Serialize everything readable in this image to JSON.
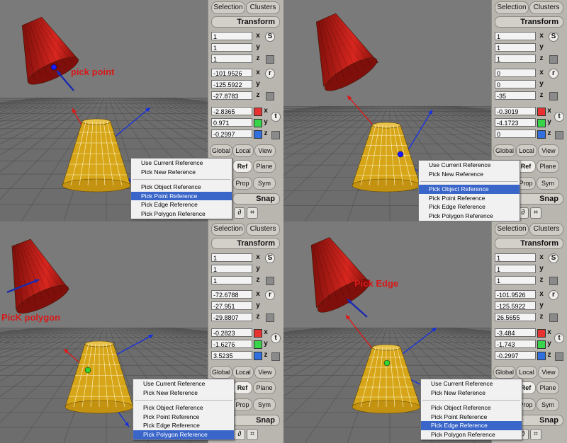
{
  "panel": {
    "tab_selection": "Selection",
    "tab_clusters": "Clusters",
    "transform_title": "Transform",
    "axis_x": "x",
    "axis_y": "y",
    "axis_z": "z",
    "btn_s": "S",
    "btn_r": "r",
    "btn_t": "t",
    "btn_global": "Global",
    "btn_local": "Local",
    "btn_view": "View",
    "btn_ref": "Ref",
    "btn_plane": "Plane",
    "btn_prop": "Prop",
    "btn_sym": "Sym",
    "snap_title": "Snap",
    "colors": {
      "x": "#e83232",
      "y": "#38d44a",
      "z": "#2f6fe0"
    }
  },
  "menu": {
    "items": [
      "Use Current Reference",
      "Pick New Reference",
      "Pick Object Reference",
      "Pick Point Reference",
      "Pick Edge Reference",
      "Pick Polygon Reference"
    ],
    "selected_color": "#3a66c9"
  },
  "quads": [
    {
      "callout": "pick point",
      "scale": [
        "1",
        "1",
        "1"
      ],
      "rotation": [
        "-101.9526",
        "-125.5922",
        "-27.8783"
      ],
      "translation": [
        "-2.8365",
        "0.971",
        "-0.2997"
      ],
      "selected_item": 3
    },
    {
      "callout": "",
      "scale": [
        "1",
        "1",
        "1"
      ],
      "rotation": [
        "0",
        "0",
        "-35"
      ],
      "translation": [
        "-0.3019",
        "-4.1723",
        "0"
      ],
      "selected_item": 2
    },
    {
      "callout": "PicK polygon",
      "scale": [
        "1",
        "1",
        "1"
      ],
      "rotation": [
        "-72.6788",
        "-27.951",
        "-29.8807"
      ],
      "translation": [
        "-0.2823",
        "-1.6276",
        "3.5235"
      ],
      "selected_item": 5
    },
    {
      "callout": "Pick Edge",
      "scale": [
        "1",
        "1",
        "1"
      ],
      "rotation": [
        "-101.9526",
        "-125.5922",
        "26.5655"
      ],
      "translation": [
        "-3.484",
        "-1.743",
        "-0.2997"
      ],
      "selected_item": 4
    }
  ]
}
